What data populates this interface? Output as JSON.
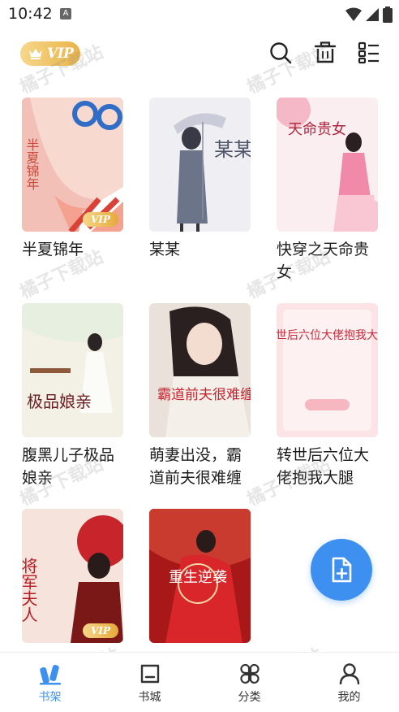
{
  "status_bar": {
    "time": "10:42",
    "notification_icon": "A"
  },
  "header": {
    "vip_label": "VIP",
    "icons": [
      "search-icon",
      "trash-icon",
      "list-view-icon"
    ]
  },
  "books": [
    {
      "title": "半夏锦年",
      "vip": true,
      "cover_text": "半夏锦年"
    },
    {
      "title": "某某",
      "vip": false,
      "cover_text": "某某"
    },
    {
      "title": "快穿之天命贵女",
      "vip": false,
      "cover_text": "天命贵女"
    },
    {
      "title": "腹黑儿子极品娘亲",
      "vip": false,
      "cover_text": "极品娘亲"
    },
    {
      "title": "萌妻出没，霸道前夫很难缠",
      "vip": false,
      "cover_text": "霸道前夫很难缠"
    },
    {
      "title": "转世后六位大佬抱我大腿",
      "vip": false,
      "cover_text": "转世后六位大佬抱我大腿"
    },
    {
      "title": "",
      "vip": true,
      "cover_text": "将军夫人"
    },
    {
      "title": "",
      "vip": false,
      "cover_text": "重生逆袭"
    }
  ],
  "watermark": "橘子下载站",
  "fab": {
    "icon": "add-file-icon",
    "color": "#3d8ff0"
  },
  "bottom_nav": [
    {
      "label": "书架",
      "icon": "bookshelf-icon",
      "active": true
    },
    {
      "label": "书城",
      "icon": "bookstore-icon",
      "active": false
    },
    {
      "label": "分类",
      "icon": "category-icon",
      "active": false
    },
    {
      "label": "我的",
      "icon": "profile-icon",
      "active": false
    }
  ],
  "colors": {
    "accent": "#3d8ff0",
    "vip_gold": "#e9b347"
  }
}
